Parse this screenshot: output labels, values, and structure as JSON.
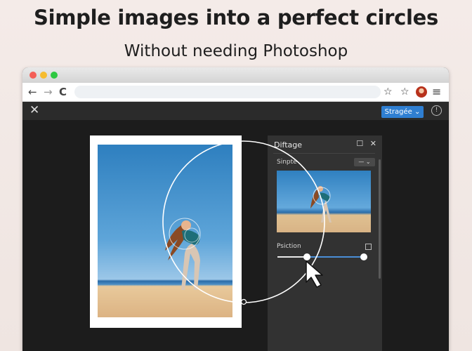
{
  "headline": "Simple images into a perfect circles",
  "subheadline": "Without needing Photoshop",
  "browser": {
    "nav_back": "←",
    "nav_forward": "→",
    "nav_reload": "C",
    "star_icon": "☆",
    "bookmark_icon": "☆",
    "menu_icon": "≡"
  },
  "app": {
    "close_label": "✕",
    "action_button": "Stragée",
    "action_chevron": "⌄",
    "help_label": "!"
  },
  "panel": {
    "title": "Diftage",
    "shape_label": "Sinpte",
    "shape_select": "— ⌄",
    "position_label": "Psiction",
    "slider_value": 0.3
  },
  "colors": {
    "accent": "#2f7fd2",
    "slider": "#4a8ed6"
  }
}
